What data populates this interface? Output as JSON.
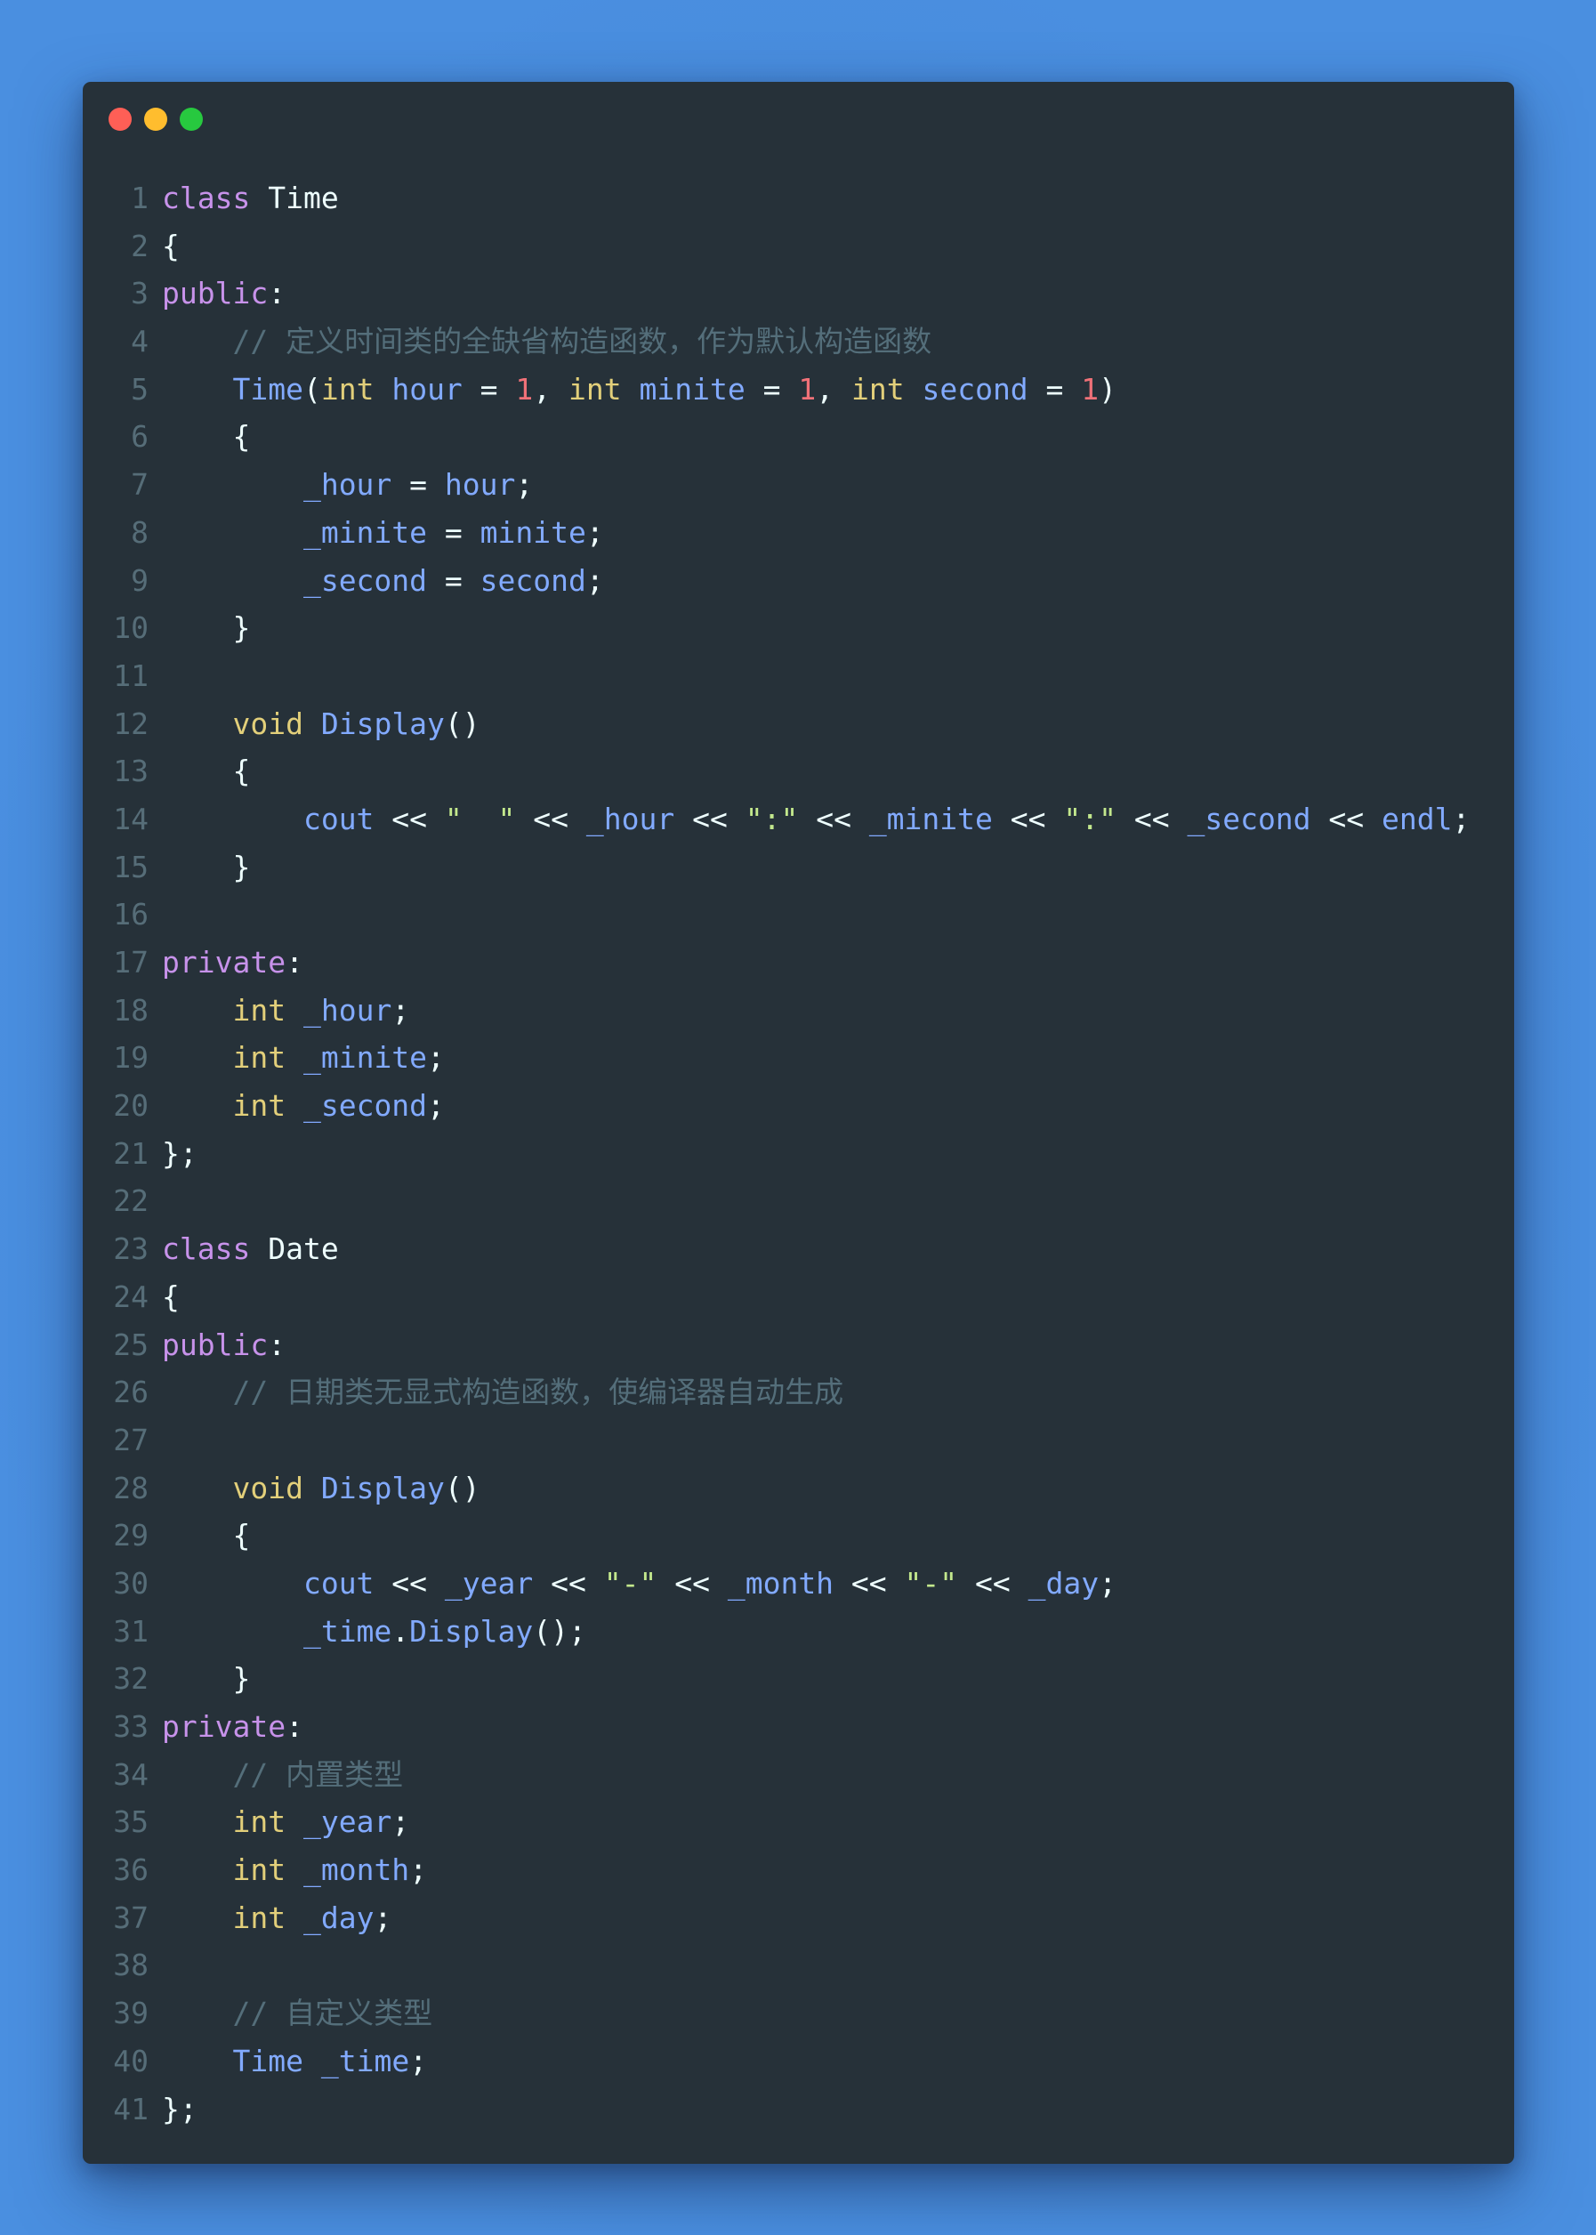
{
  "window": {
    "controls": [
      {
        "name": "close",
        "color": "#ff5f56"
      },
      {
        "name": "minimize",
        "color": "#ffbd2e"
      },
      {
        "name": "maximize",
        "color": "#27c93f"
      }
    ]
  },
  "theme": {
    "background": "#4a8fe0",
    "editor_background": "#263139",
    "line_number": "#566d78",
    "keyword": "#c792ea",
    "type": "#e2cf7a",
    "identifier": "#82aaff",
    "number": "#f07178",
    "string": "#c3e88d",
    "comment": "#546e7a",
    "plain": "#eeffff"
  },
  "code": {
    "language": "cpp",
    "lines": [
      [
        [
          "kw",
          "class"
        ],
        [
          "p",
          " "
        ],
        [
          "cls",
          "Time"
        ]
      ],
      [
        [
          "p",
          "{"
        ]
      ],
      [
        [
          "kw",
          "public"
        ],
        [
          "p",
          ":"
        ]
      ],
      [
        [
          "p",
          "    "
        ],
        [
          "com",
          "// 定义时间类的全缺省构造函数，作为默认构造函数"
        ]
      ],
      [
        [
          "p",
          "    "
        ],
        [
          "id",
          "Time"
        ],
        [
          "p",
          "("
        ],
        [
          "type",
          "int"
        ],
        [
          "p",
          " "
        ],
        [
          "id",
          "hour"
        ],
        [
          "p",
          " = "
        ],
        [
          "num",
          "1"
        ],
        [
          "p",
          ", "
        ],
        [
          "type",
          "int"
        ],
        [
          "p",
          " "
        ],
        [
          "id",
          "minite"
        ],
        [
          "p",
          " = "
        ],
        [
          "num",
          "1"
        ],
        [
          "p",
          ", "
        ],
        [
          "type",
          "int"
        ],
        [
          "p",
          " "
        ],
        [
          "id",
          "second"
        ],
        [
          "p",
          " = "
        ],
        [
          "num",
          "1"
        ],
        [
          "p",
          ")"
        ]
      ],
      [
        [
          "p",
          "    {"
        ]
      ],
      [
        [
          "p",
          "        "
        ],
        [
          "id",
          "_hour"
        ],
        [
          "p",
          " = "
        ],
        [
          "id",
          "hour"
        ],
        [
          "p",
          ";"
        ]
      ],
      [
        [
          "p",
          "        "
        ],
        [
          "id",
          "_minite"
        ],
        [
          "p",
          " = "
        ],
        [
          "id",
          "minite"
        ],
        [
          "p",
          ";"
        ]
      ],
      [
        [
          "p",
          "        "
        ],
        [
          "id",
          "_second"
        ],
        [
          "p",
          " = "
        ],
        [
          "id",
          "second"
        ],
        [
          "p",
          ";"
        ]
      ],
      [
        [
          "p",
          "    }"
        ]
      ],
      [],
      [
        [
          "p",
          "    "
        ],
        [
          "type",
          "void"
        ],
        [
          "p",
          " "
        ],
        [
          "id",
          "Display"
        ],
        [
          "p",
          "()"
        ]
      ],
      [
        [
          "p",
          "    {"
        ]
      ],
      [
        [
          "p",
          "        "
        ],
        [
          "id",
          "cout"
        ],
        [
          "p",
          " << "
        ],
        [
          "str",
          "\"  \""
        ],
        [
          "p",
          " << "
        ],
        [
          "id",
          "_hour"
        ],
        [
          "p",
          " << "
        ],
        [
          "str",
          "\":\""
        ],
        [
          "p",
          " << "
        ],
        [
          "id",
          "_minite"
        ],
        [
          "p",
          " << "
        ],
        [
          "str",
          "\":\""
        ],
        [
          "p",
          " << "
        ],
        [
          "id",
          "_second"
        ],
        [
          "p",
          " << "
        ],
        [
          "id",
          "endl"
        ],
        [
          "p",
          ";"
        ]
      ],
      [
        [
          "p",
          "    }"
        ]
      ],
      [],
      [
        [
          "kw",
          "private"
        ],
        [
          "p",
          ":"
        ]
      ],
      [
        [
          "p",
          "    "
        ],
        [
          "type",
          "int"
        ],
        [
          "p",
          " "
        ],
        [
          "id",
          "_hour"
        ],
        [
          "p",
          ";"
        ]
      ],
      [
        [
          "p",
          "    "
        ],
        [
          "type",
          "int"
        ],
        [
          "p",
          " "
        ],
        [
          "id",
          "_minite"
        ],
        [
          "p",
          ";"
        ]
      ],
      [
        [
          "p",
          "    "
        ],
        [
          "type",
          "int"
        ],
        [
          "p",
          " "
        ],
        [
          "id",
          "_second"
        ],
        [
          "p",
          ";"
        ]
      ],
      [
        [
          "p",
          "};"
        ]
      ],
      [],
      [
        [
          "kw",
          "class"
        ],
        [
          "p",
          " "
        ],
        [
          "cls",
          "Date"
        ]
      ],
      [
        [
          "p",
          "{"
        ]
      ],
      [
        [
          "kw",
          "public"
        ],
        [
          "p",
          ":"
        ]
      ],
      [
        [
          "p",
          "    "
        ],
        [
          "com",
          "// 日期类无显式构造函数，使编译器自动生成"
        ]
      ],
      [],
      [
        [
          "p",
          "    "
        ],
        [
          "type",
          "void"
        ],
        [
          "p",
          " "
        ],
        [
          "id",
          "Display"
        ],
        [
          "p",
          "()"
        ]
      ],
      [
        [
          "p",
          "    {"
        ]
      ],
      [
        [
          "p",
          "        "
        ],
        [
          "id",
          "cout"
        ],
        [
          "p",
          " << "
        ],
        [
          "id",
          "_year"
        ],
        [
          "p",
          " << "
        ],
        [
          "str",
          "\"-\""
        ],
        [
          "p",
          " << "
        ],
        [
          "id",
          "_month"
        ],
        [
          "p",
          " << "
        ],
        [
          "str",
          "\"-\""
        ],
        [
          "p",
          " << "
        ],
        [
          "id",
          "_day"
        ],
        [
          "p",
          ";"
        ]
      ],
      [
        [
          "p",
          "        "
        ],
        [
          "id",
          "_time"
        ],
        [
          "p",
          "."
        ],
        [
          "id",
          "Display"
        ],
        [
          "p",
          "();"
        ]
      ],
      [
        [
          "p",
          "    }"
        ]
      ],
      [
        [
          "kw",
          "private"
        ],
        [
          "p",
          ":"
        ]
      ],
      [
        [
          "p",
          "    "
        ],
        [
          "com",
          "// 内置类型"
        ]
      ],
      [
        [
          "p",
          "    "
        ],
        [
          "type",
          "int"
        ],
        [
          "p",
          " "
        ],
        [
          "id",
          "_year"
        ],
        [
          "p",
          ";"
        ]
      ],
      [
        [
          "p",
          "    "
        ],
        [
          "type",
          "int"
        ],
        [
          "p",
          " "
        ],
        [
          "id",
          "_month"
        ],
        [
          "p",
          ";"
        ]
      ],
      [
        [
          "p",
          "    "
        ],
        [
          "type",
          "int"
        ],
        [
          "p",
          " "
        ],
        [
          "id",
          "_day"
        ],
        [
          "p",
          ";"
        ]
      ],
      [],
      [
        [
          "p",
          "    "
        ],
        [
          "com",
          "// 自定义类型"
        ]
      ],
      [
        [
          "p",
          "    "
        ],
        [
          "id",
          "Time"
        ],
        [
          "p",
          " "
        ],
        [
          "id",
          "_time"
        ],
        [
          "p",
          ";"
        ]
      ],
      [
        [
          "p",
          "};"
        ]
      ]
    ]
  }
}
